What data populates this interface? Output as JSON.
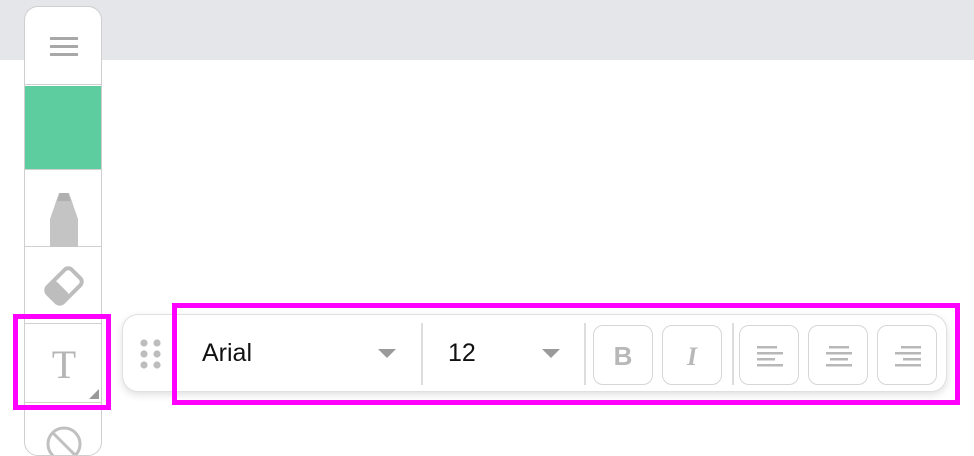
{
  "canvas": {
    "background": "#ffffff",
    "top_band_color": "#e5e6ea"
  },
  "palette": {
    "tools": [
      {
        "id": "menu",
        "icon": "hamburger-menu-icon"
      },
      {
        "id": "color",
        "icon": "color-swatch",
        "color": "#5dcd9f"
      },
      {
        "id": "pen",
        "icon": "pen-icon"
      },
      {
        "id": "eraser",
        "icon": "eraser-icon"
      },
      {
        "id": "text",
        "icon": "text-tool-icon",
        "glyph": "T",
        "selected": true
      },
      {
        "id": "shape",
        "icon": "no-sign-icon"
      }
    ]
  },
  "format_toolbar": {
    "drag_icon": "drag-handle-icon",
    "font": {
      "selected": "Arial"
    },
    "size": {
      "selected": "12"
    },
    "bold_glyph": "B",
    "italic_glyph": "I",
    "align_buttons": [
      "align-left-icon",
      "align-center-icon",
      "align-right-icon"
    ]
  },
  "highlights": {
    "color": "#ff00ff"
  }
}
